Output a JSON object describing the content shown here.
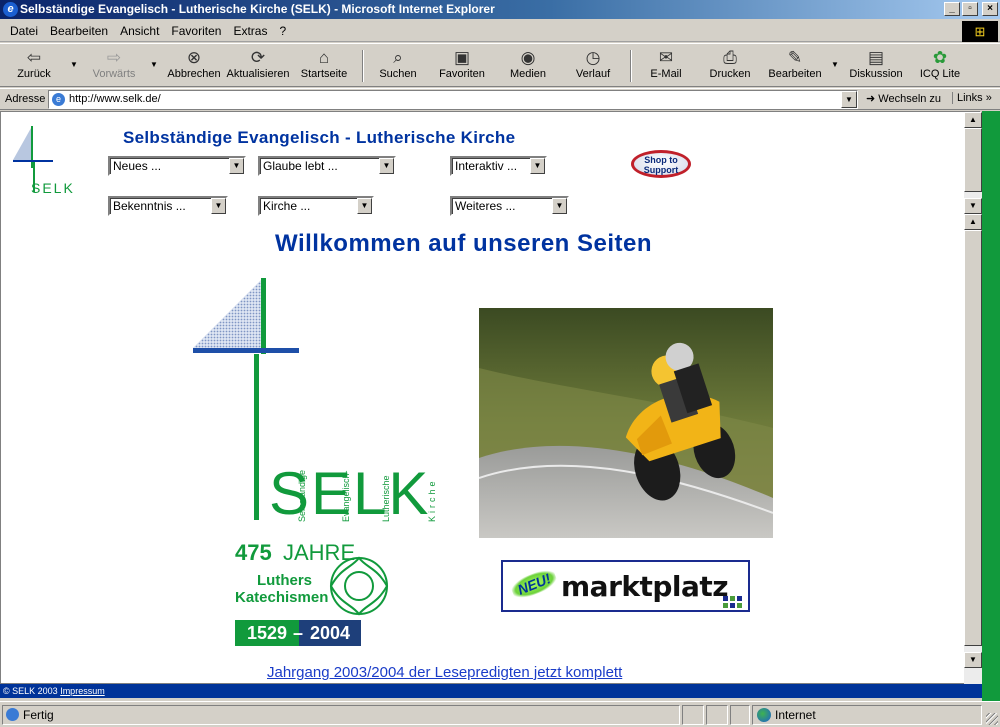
{
  "window": {
    "title": "Selbständige Evangelisch - Lutherische Kirche (SELK) - Microsoft Internet Explorer",
    "controls": [
      "_",
      "▫",
      "×"
    ]
  },
  "menu": [
    "Datei",
    "Bearbeiten",
    "Ansicht",
    "Favoriten",
    "Extras",
    "?"
  ],
  "toolbar": {
    "back": "Zurück",
    "forward": "Vorwärts",
    "stop": "Abbrechen",
    "refresh": "Aktualisieren",
    "home": "Startseite",
    "search": "Suchen",
    "favorites": "Favoriten",
    "media": "Medien",
    "history": "Verlauf",
    "mail": "E-Mail",
    "print": "Drucken",
    "edit": "Bearbeiten",
    "discuss": "Diskussion",
    "icq": "ICQ Lite"
  },
  "address": {
    "label": "Adresse",
    "url": "http://www.selk.de/",
    "go": "Wechseln zu",
    "links": "Links"
  },
  "page": {
    "logo_small": "SELK",
    "site_title": "Selbständige Evangelisch - Lutherische Kirche",
    "selects_row1": [
      "Neues ...",
      "Glaube lebt ...",
      "Interaktiv ..."
    ],
    "selects_row2": [
      "Bekenntnis ...",
      "Kirche ...",
      "Weiteres ..."
    ],
    "shop_button": "Shop to Support",
    "welcome": "Willkommen auf unseren Seiten",
    "logo_big": {
      "word": "SELK",
      "small1": "Selbständige",
      "small2": "Evangelisch-",
      "small3": "Lutherische",
      "small4": "Kirche"
    },
    "jubilee": {
      "years": "475",
      "jahre": "JAHRE",
      "line1": "Luthers",
      "line2": "Katechismen",
      "from": "1529",
      "to": "2004"
    },
    "marktplatz": {
      "badge": "NEU!",
      "name": "marktplatz"
    },
    "news_link": "Jahrgang 2003/2004 der Lesepredigten jetzt komplett",
    "footer_copy": "© SELK 2003",
    "footer_link": "Impressum"
  },
  "status": {
    "text": "Fertig",
    "zone": "Internet"
  },
  "colors": {
    "brand_blue": "#0033a0",
    "brand_green": "#119a3c",
    "footer_blue": "#003399"
  }
}
